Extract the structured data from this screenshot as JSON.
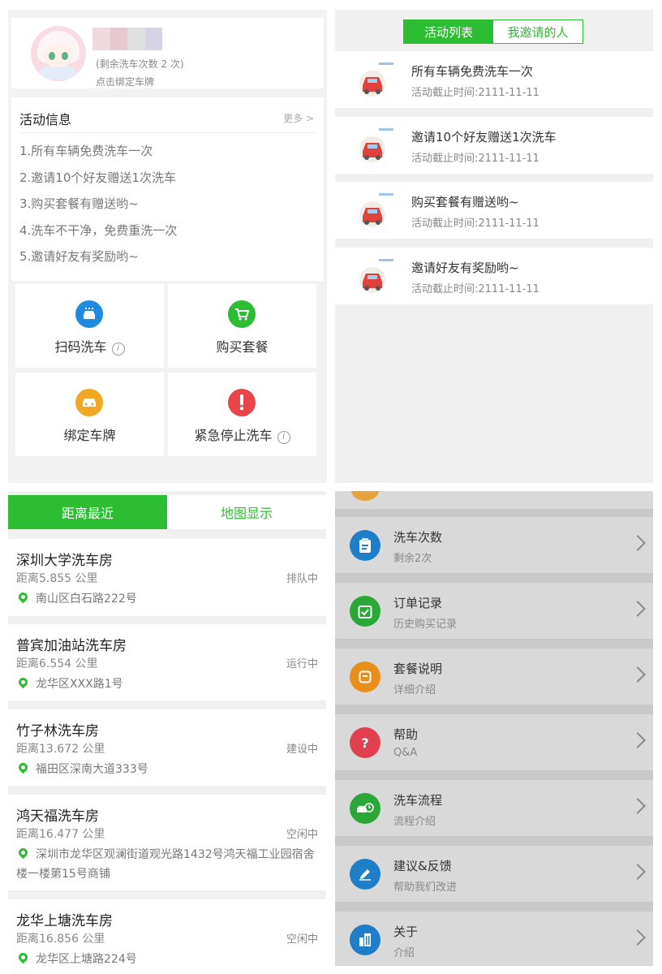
{
  "profile": {
    "wash_count_text": "(剩余洗车次数 2 次)",
    "bind_plate_text": "点击绑定车牌"
  },
  "activity": {
    "title": "活动信息",
    "more": "更多 >",
    "items": [
      "1.所有车辆免费洗车一次",
      "2.邀请10个好友赠送1次洗车",
      "3.购买套餐有赠送哟~",
      "4.洗车不干净，免费重洗一次",
      "5.邀请好友有奖励哟~"
    ]
  },
  "grid": {
    "scan_wash": "扫码洗车",
    "buy_package": "购买套餐",
    "bind_plate": "绑定车牌",
    "emergency_stop": "紧急停止洗车",
    "info_glyph": "i",
    "colors": {
      "scan": "#1e8be0",
      "buy": "#2dbd32",
      "bind": "#f0a822",
      "stop": "#e8454a"
    }
  },
  "activity_list": {
    "tab_active": "活动列表",
    "tab_inactive": "我邀请的人",
    "cards": [
      {
        "title": "所有车辆免费洗车一次",
        "deadline": "活动截止时间:2111-11-11"
      },
      {
        "title": "邀请10个好友赠送1次洗车",
        "deadline": "活动截止时间:2111-11-11"
      },
      {
        "title": "购买套餐有赠送哟~",
        "deadline": "活动截止时间:2111-11-11"
      },
      {
        "title": "邀请好友有奖励哟~",
        "deadline": "活动截止时间:2111-11-11"
      }
    ]
  },
  "stations": {
    "tab_nearest": "距离最近",
    "tab_map": "地图显示",
    "accent": "#2dbd32",
    "items": [
      {
        "name": "深圳大学洗车房",
        "distance": "距离5.855 公里",
        "status": "排队中",
        "address": "南山区白石路222号"
      },
      {
        "name": "普宾加油站洗车房",
        "distance": "距离6.554 公里",
        "status": "运行中",
        "address": "龙华区XXX路1号"
      },
      {
        "name": "竹子林洗车房",
        "distance": "距离13.672 公里",
        "status": "建设中",
        "address": "福田区深南大道333号"
      },
      {
        "name": "鸿天福洗车房",
        "distance": "距离16.477 公里",
        "status": "空闲中",
        "address": "深圳市龙华区观澜街道观光路1432号鸿天福工业园宿舍楼一楼第15号商铺"
      },
      {
        "name": "龙华上塘洗车房",
        "distance": "距离16.856 公里",
        "status": "空闲中",
        "address": "龙华区上塘路224号"
      }
    ]
  },
  "menu": {
    "items": [
      {
        "title": "洗车次数",
        "sub": "剩余2次",
        "icon": "clipboard-icon",
        "color": "#1e7fc8"
      },
      {
        "title": "订单记录",
        "sub": "历史购买记录",
        "icon": "calendar-check-icon",
        "color": "#2aa836"
      },
      {
        "title": "套餐说明",
        "sub": "详细介绍",
        "icon": "package-icon",
        "color": "#e88e1a"
      },
      {
        "title": "帮助",
        "sub": "Q&A",
        "icon": "question-icon",
        "color": "#e04050"
      },
      {
        "title": "洗车流程",
        "sub": "流程介绍",
        "icon": "car-clock-icon",
        "color": "#2aa836"
      },
      {
        "title": "建议&反馈",
        "sub": "帮助我们改进",
        "icon": "pencil-icon",
        "color": "#1e7fc8"
      },
      {
        "title": "关于",
        "sub": "介绍",
        "icon": "building-icon",
        "color": "#1e7fc8"
      }
    ],
    "question_glyph": "?"
  }
}
